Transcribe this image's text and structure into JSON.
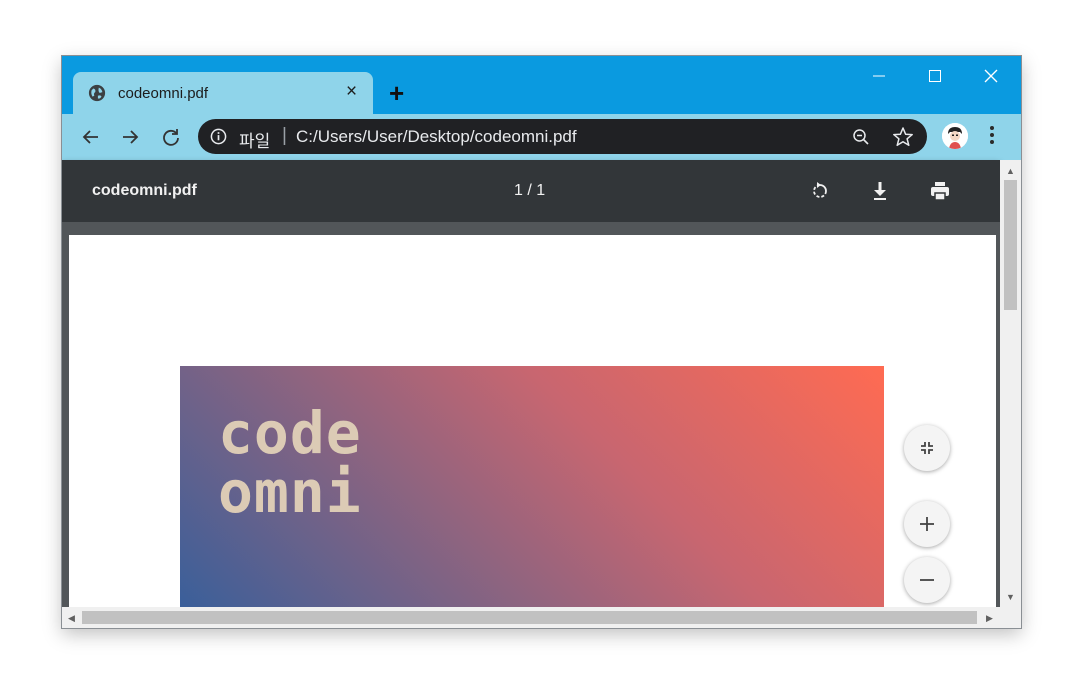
{
  "tab": {
    "title": "codeomni.pdf",
    "close_label": "×",
    "favicon": "globe-icon"
  },
  "new_tab_label": "+",
  "window_controls": {
    "minimize": "—",
    "maximize": "☐",
    "close": "✕"
  },
  "toolbar": {
    "back": "←",
    "forward": "→",
    "reload": "C"
  },
  "omnibox": {
    "scheme": "파일",
    "separator": "|",
    "url": "C:/Users/User/Desktop/codeomni.pdf"
  },
  "pdf": {
    "title": "codeomni.pdf",
    "page_indicator": "1 / 1"
  },
  "zoom": {
    "fit": "fit-to-page-icon",
    "in": "+",
    "out": "−"
  },
  "logo_text": {
    "line1": "code",
    "line2": "omni"
  },
  "colors": {
    "titlebar": "#0a9ae0",
    "tab": "#8fd4ea",
    "omnibox": "#202124",
    "pdfbar": "#323639",
    "viewer_bg": "#525659",
    "logo": "#dccbb5"
  }
}
